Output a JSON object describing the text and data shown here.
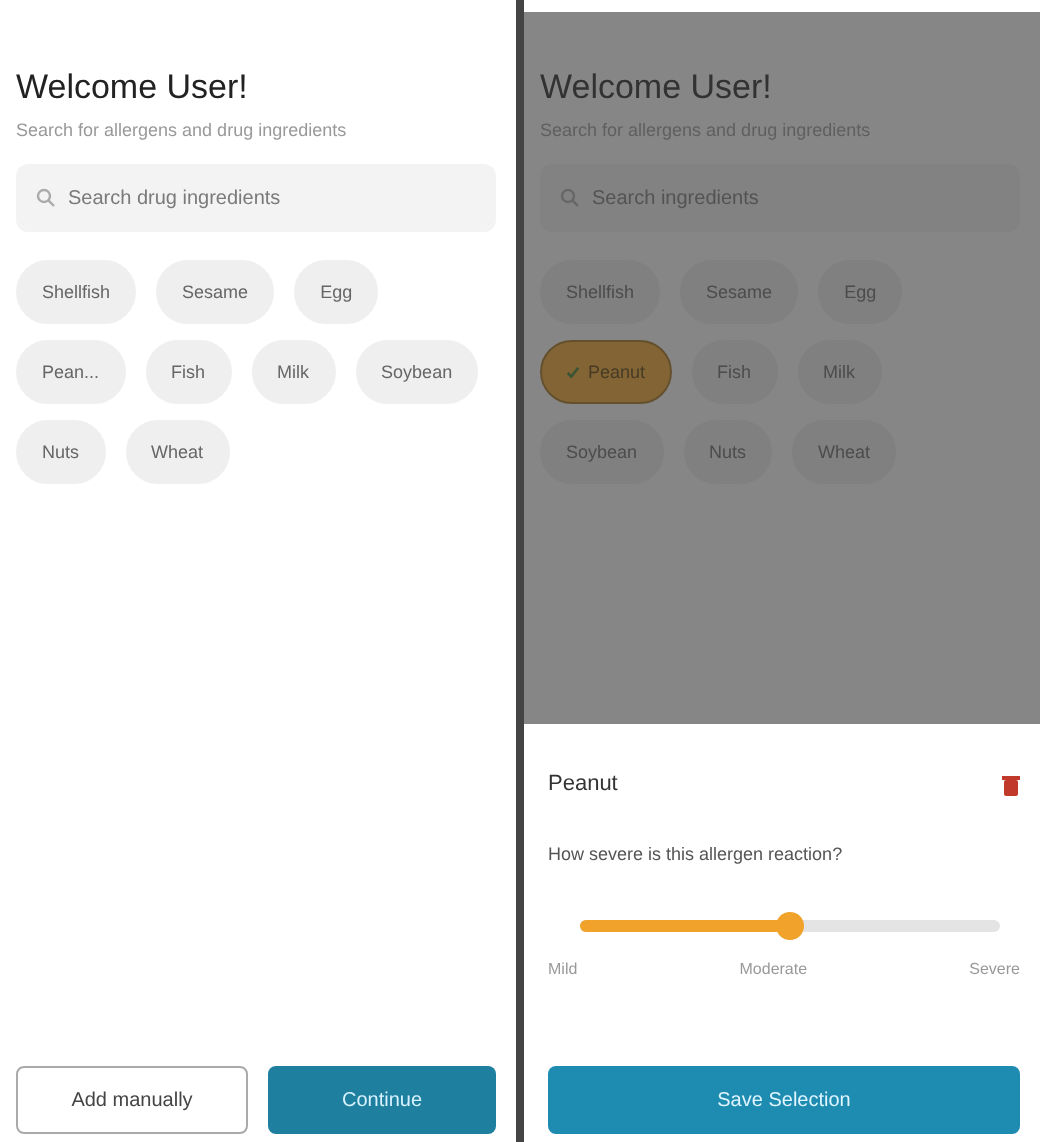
{
  "left_screen": {
    "title": "Welcome User!",
    "subtitle": "Search for allergens and drug ingredients",
    "search": {
      "placeholder": "Search drug ingredients"
    },
    "chips": [
      {
        "label": "Shellfish",
        "selected": false
      },
      {
        "label": "Sesame",
        "selected": false
      },
      {
        "label": "Egg",
        "selected": false
      },
      {
        "label": "Pean...",
        "selected": false
      },
      {
        "label": "Fish",
        "selected": false
      },
      {
        "label": "Milk",
        "selected": false
      },
      {
        "label": "Soybean",
        "selected": false
      },
      {
        "label": "Nuts",
        "selected": false
      },
      {
        "label": "Wheat",
        "selected": false
      }
    ],
    "buttons": [
      {
        "label": "Add manually",
        "kind": "outline"
      },
      {
        "label": "Continue",
        "kind": "primary"
      }
    ]
  },
  "right_screen": {
    "title": "Welcome User!",
    "subtitle": "Search for allergens and drug ingredients",
    "search": {
      "placeholder": "Search ingredients"
    },
    "chips": [
      {
        "label": "Shellfish",
        "selected": false
      },
      {
        "label": "Sesame",
        "selected": false
      },
      {
        "label": "Egg",
        "selected": false
      },
      {
        "label": "Peanut",
        "selected": true
      },
      {
        "label": "Fish",
        "selected": false
      },
      {
        "label": "Milk",
        "selected": false
      },
      {
        "label": "Soybean",
        "selected": false
      },
      {
        "label": "Nuts",
        "selected": false
      },
      {
        "label": "Wheat",
        "selected": false
      }
    ],
    "sheet": {
      "allergen": "Peanut",
      "question": "How severe is this allergen reaction?",
      "severity": {
        "level": 0.5,
        "labels": [
          "Mild",
          "Moderate",
          "Severe"
        ]
      },
      "button": "Save Selection"
    }
  }
}
